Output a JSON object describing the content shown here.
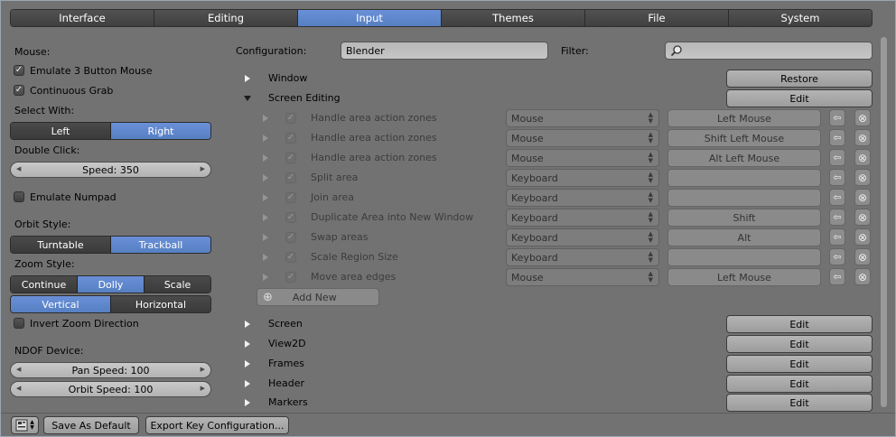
{
  "tabs": [
    {
      "label": "Interface",
      "active": false
    },
    {
      "label": "Editing",
      "active": false
    },
    {
      "label": "Input",
      "active": true
    },
    {
      "label": "Themes",
      "active": false
    },
    {
      "label": "File",
      "active": false
    },
    {
      "label": "System",
      "active": false
    }
  ],
  "left": {
    "mouse_label": "Mouse:",
    "emulate3": {
      "label": "Emulate 3 Button Mouse",
      "checked": true
    },
    "continuous_grab": {
      "label": "Continuous Grab",
      "checked": true
    },
    "select_with_label": "Select With:",
    "select_with": [
      "Left",
      "Right"
    ],
    "select_with_selected": "Right",
    "double_click_label": "Double Click:",
    "double_click_slider": "Speed: 350",
    "emulate_numpad": {
      "label": "Emulate Numpad",
      "checked": false
    },
    "orbit_style_label": "Orbit Style:",
    "orbit_style": [
      "Turntable",
      "Trackball"
    ],
    "orbit_style_selected": "Trackball",
    "zoom_style_label": "Zoom Style:",
    "zoom_style": [
      "Continue",
      "Dolly",
      "Scale"
    ],
    "zoom_style_selected": "Dolly",
    "zoom_axis": [
      "Vertical",
      "Horizontal"
    ],
    "zoom_axis_selected": "Vertical",
    "invert_zoom": {
      "label": "Invert Zoom Direction",
      "checked": false
    },
    "ndof_label": "NDOF Device:",
    "pan_speed": "Pan Speed: 100",
    "orbit_speed": "Orbit Speed: 100"
  },
  "right": {
    "configuration_label": "Configuration:",
    "configuration_value": "Blender",
    "filter_label": "Filter:",
    "filter_value": "",
    "window_label": "Window",
    "restore_label": "Restore",
    "screen_editing_label": "Screen Editing",
    "edit_label": "Edit",
    "keymap_items": [
      {
        "name": "Handle area action zones",
        "type": "Mouse",
        "key": "Left Mouse"
      },
      {
        "name": "Handle area action zones",
        "type": "Mouse",
        "key": "Shift Left Mouse"
      },
      {
        "name": "Handle area action zones",
        "type": "Mouse",
        "key": "Alt Left Mouse"
      },
      {
        "name": "Split area",
        "type": "Keyboard",
        "key": ""
      },
      {
        "name": "Join area",
        "type": "Keyboard",
        "key": ""
      },
      {
        "name": "Duplicate Area into New Window",
        "type": "Keyboard",
        "key": "Shift"
      },
      {
        "name": "Swap areas",
        "type": "Keyboard",
        "key": "Alt"
      },
      {
        "name": "Scale Region Size",
        "type": "Keyboard",
        "key": ""
      },
      {
        "name": "Move area edges",
        "type": "Mouse",
        "key": "Left Mouse"
      }
    ],
    "add_new_label": "Add New",
    "sections": [
      {
        "label": "Screen",
        "button": "Edit"
      },
      {
        "label": "View2D",
        "button": "Edit"
      },
      {
        "label": "Frames",
        "button": "Edit"
      },
      {
        "label": "Header",
        "button": "Edit"
      },
      {
        "label": "Markers",
        "button": "Edit"
      }
    ]
  },
  "footer": {
    "save_default": "Save As Default",
    "export_keys": "Export Key Configuration..."
  },
  "colors": {
    "accent": "#5680c2",
    "background": "#727272",
    "tab": "#444444"
  }
}
